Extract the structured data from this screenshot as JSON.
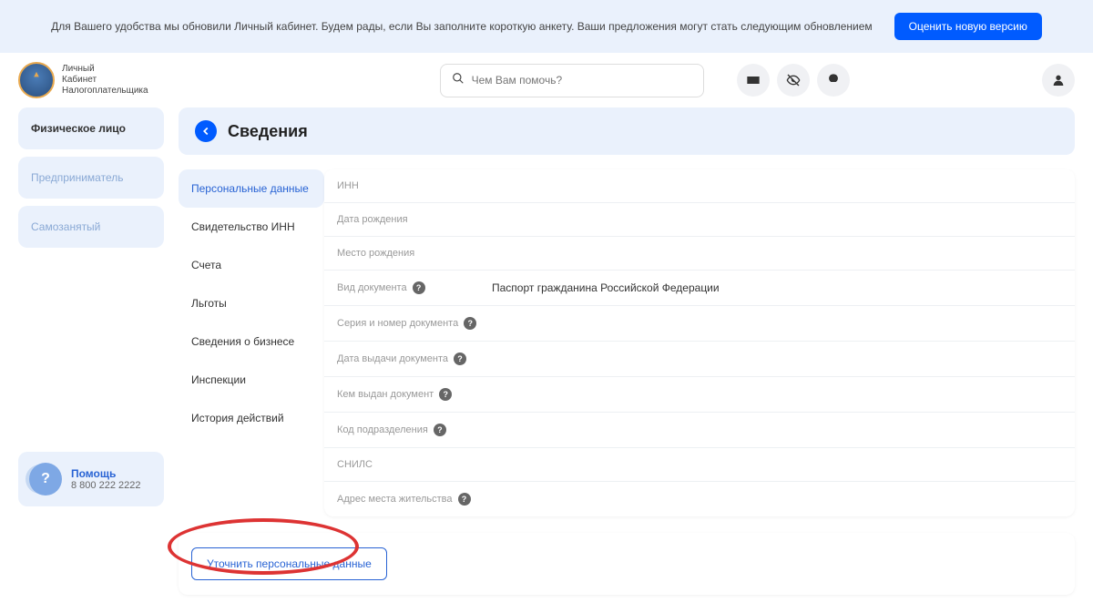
{
  "banner": {
    "text": "Для Вашего удобства мы обновили Личный кабинет. Будем рады, если Вы заполните короткую анкету. Ваши предложения могут стать следующим обновлением",
    "button": "Оценить новую версию"
  },
  "logo": {
    "line1": "Личный",
    "line2": "Кабинет",
    "line3": "Налогоплательщика"
  },
  "search": {
    "placeholder": "Чем Вам помочь?"
  },
  "entity_tabs": [
    {
      "label": "Физическое лицо",
      "active": true
    },
    {
      "label": "Предприниматель",
      "active": false
    },
    {
      "label": "Самозанятый",
      "active": false
    }
  ],
  "page_title": "Сведения",
  "side_tabs": [
    {
      "label": "Персональные данные",
      "active": true
    },
    {
      "label": "Свидетельство ИНН",
      "active": false
    },
    {
      "label": "Счета",
      "active": false
    },
    {
      "label": "Льготы",
      "active": false
    },
    {
      "label": "Сведения о бизнесе",
      "active": false
    },
    {
      "label": "Инспекции",
      "active": false
    },
    {
      "label": "История действий",
      "active": false
    }
  ],
  "fields": [
    {
      "label": "ИНН",
      "value": "",
      "hint": false
    },
    {
      "label": "Дата рождения",
      "value": "",
      "hint": false
    },
    {
      "label": "Место рождения",
      "value": "",
      "hint": false
    },
    {
      "label": "Вид документа",
      "value": "Паспорт гражданина Российской Федерации",
      "hint": true
    },
    {
      "label": "Серия и номер документа",
      "value": "",
      "hint": true
    },
    {
      "label": "Дата выдачи документа",
      "value": "",
      "hint": true
    },
    {
      "label": "Кем выдан документ",
      "value": "",
      "hint": true
    },
    {
      "label": "Код подразделения",
      "value": "",
      "hint": true
    },
    {
      "label": "СНИЛС",
      "value": "",
      "hint": false
    },
    {
      "label": "Адрес места жительства",
      "value": "",
      "hint": true
    }
  ],
  "action_button": "Уточнить персональные данные",
  "help": {
    "title": "Помощь",
    "phone": "8 800 222 2222"
  }
}
